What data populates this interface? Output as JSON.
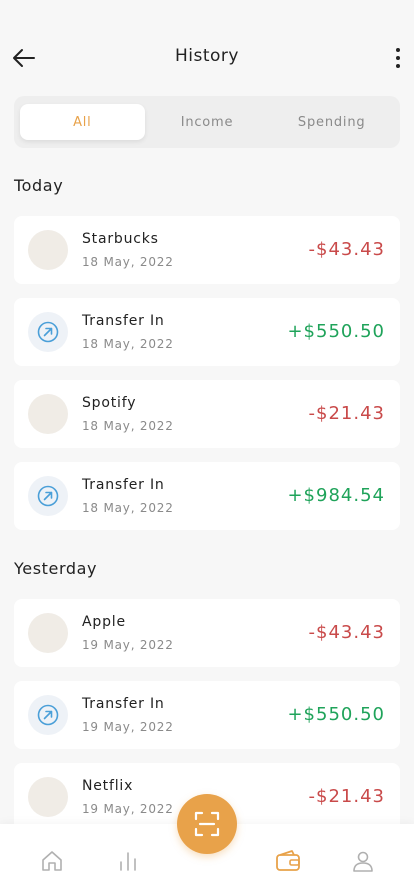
{
  "header": {
    "title": "History",
    "back_icon": "arrow-left-icon",
    "more_icon": "more-vertical-icon"
  },
  "tabs": [
    {
      "label": "All",
      "active": true
    },
    {
      "label": "Income",
      "active": false
    },
    {
      "label": "Spending",
      "active": false
    }
  ],
  "sections": {
    "today": {
      "title": "Today",
      "items": [
        {
          "name": "Starbucks",
          "date": "18 May, 2022",
          "amount": "-$43.43",
          "type": "spending"
        },
        {
          "name": "Transfer In",
          "date": "18 May, 2022",
          "amount": "+$550.50",
          "type": "income"
        },
        {
          "name": "Spotify",
          "date": "18 May, 2022",
          "amount": "-$21.43",
          "type": "spending"
        },
        {
          "name": "Transfer In",
          "date": "18 May, 2022",
          "amount": "+$984.54",
          "type": "income"
        }
      ]
    },
    "yesterday": {
      "title": "Yesterday",
      "items": [
        {
          "name": "Apple",
          "date": "19 May, 2022",
          "amount": "-$43.43",
          "type": "spending"
        },
        {
          "name": "Transfer In",
          "date": "19 May, 2022",
          "amount": "+$550.50",
          "type": "income"
        },
        {
          "name": "Netflix",
          "date": "19 May, 2022",
          "amount": "-$21.43",
          "type": "spending"
        }
      ]
    }
  },
  "bottom_nav": {
    "items": [
      "home-icon",
      "stats-icon",
      "scan-icon",
      "wallet-icon",
      "profile-icon"
    ],
    "active": "wallet-icon"
  },
  "colors": {
    "accent": "#e8a24a",
    "negative": "#c94a4a",
    "positive": "#1fa35a",
    "transfer_icon": "#4a9fd8"
  }
}
